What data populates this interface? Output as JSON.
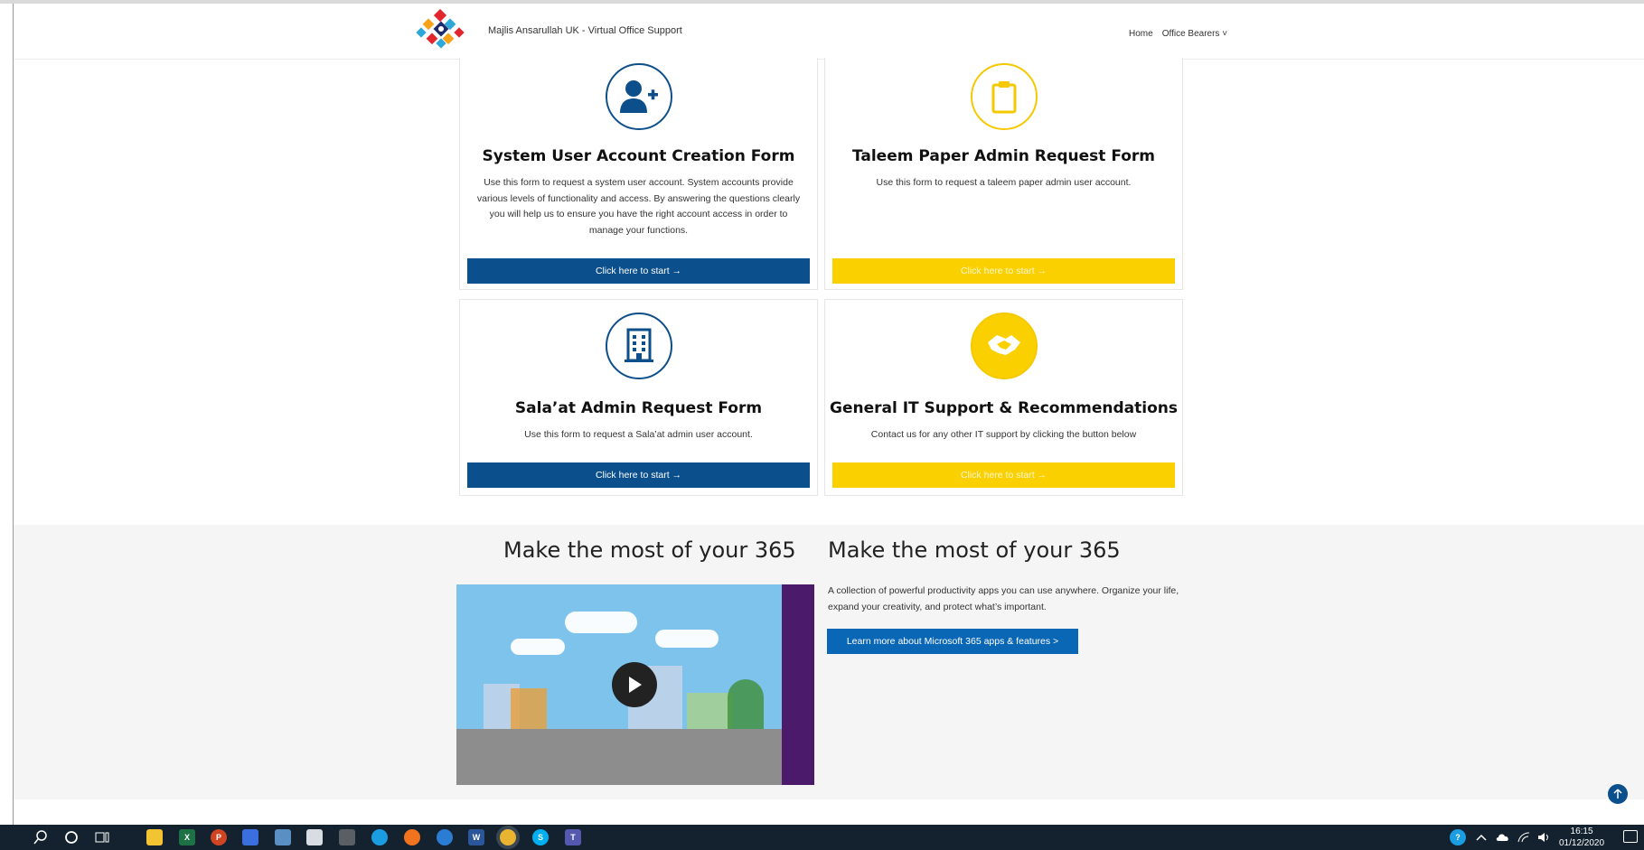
{
  "header": {
    "site_title": "Majlis Ansarullah UK - Virtual Office Support",
    "nav": {
      "home": "Home",
      "office_bearers": "Office Bearers ˅"
    }
  },
  "cards": [
    {
      "icon": "user-plus-icon",
      "title": "System User Account Creation Form",
      "description": "Use this form to request a system user account. System accounts provide various levels of functionality and access. By answering the questions clearly you will help us to ensure you have the right account access in order to manage your functions.",
      "button": "Click here to start →",
      "color": "#0b4f8c"
    },
    {
      "icon": "clipboard-icon",
      "title": "Taleem Paper Admin Request Form",
      "description": "Use this form to request a taleem paper admin user account.",
      "button": "Click here to start →",
      "color": "#fbd000"
    },
    {
      "icon": "building-icon",
      "title": "Sala’at Admin Request Form",
      "description": "Use this form to request a Sala’at admin user account.",
      "button": "Click here to start →",
      "color": "#0b4f8c"
    },
    {
      "icon": "handshake-icon",
      "title": "General IT Support & Recommendations",
      "description": "Contact us for any other IT support by clicking the button below",
      "button": "Click here to start →",
      "color": "#fbd000"
    }
  ],
  "promo": {
    "heading_left": "Make the most of your 365",
    "heading_right": "Make the most of your 365",
    "text": "A collection of powerful productivity apps you can use anywhere. Organize your life, expand your creativity, and protect what’s important.",
    "button": "Learn more about Microsoft 365 apps & features >"
  },
  "taskbar": {
    "time": "16:15",
    "date": "01/12/2020",
    "apps": [
      "file-explorer",
      "excel",
      "powerpoint",
      "app",
      "app",
      "app",
      "calculator",
      "edge",
      "firefox",
      "app",
      "word",
      "chrome",
      "skype",
      "teams"
    ]
  }
}
